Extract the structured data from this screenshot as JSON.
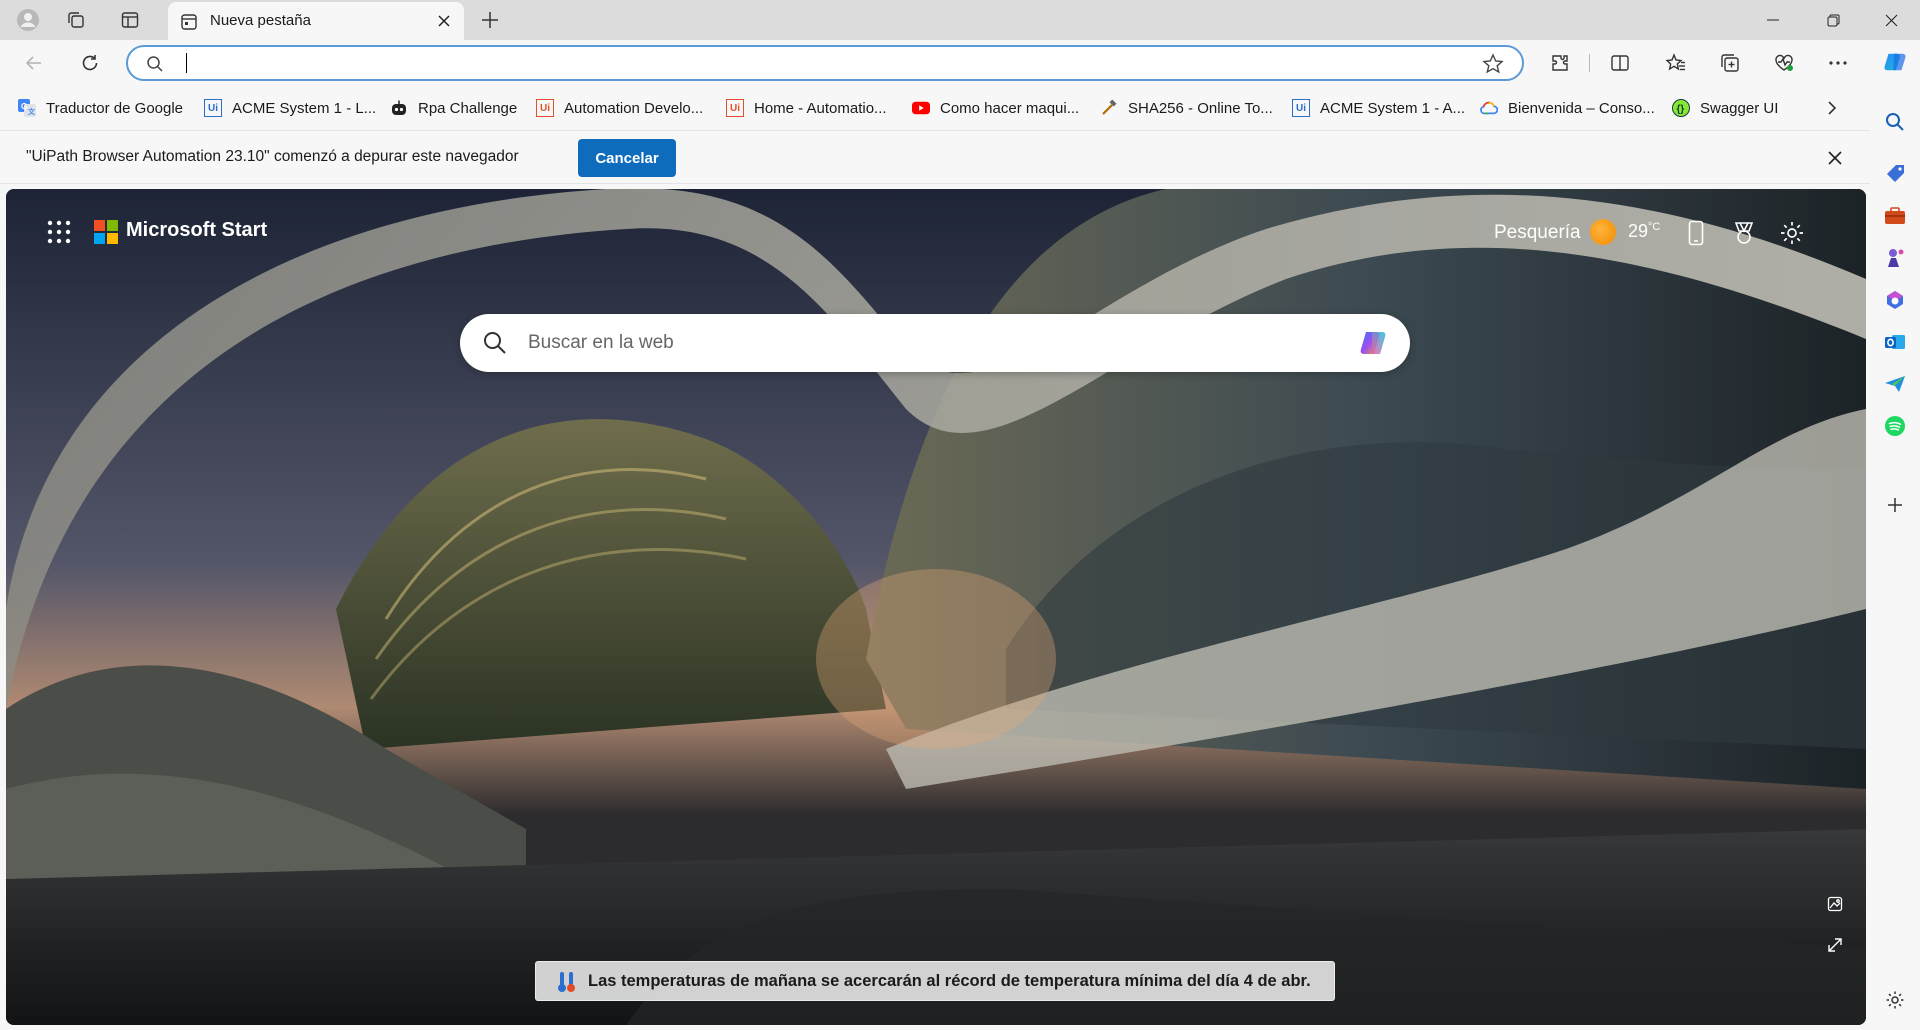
{
  "tab": {
    "title": "Nueva pestaña"
  },
  "address_bar": {
    "value": "",
    "placeholder": ""
  },
  "bookmarks": [
    {
      "label": "Traductor de Google",
      "icon": "google-translate-icon"
    },
    {
      "label": "ACME System 1 - L...",
      "icon": "uipath-icon"
    },
    {
      "label": "Rpa Challenge",
      "icon": "robot-icon"
    },
    {
      "label": "Automation Develo...",
      "icon": "uipath-icon"
    },
    {
      "label": "Home - Automatio...",
      "icon": "uipath-icon"
    },
    {
      "label": "Como hacer maqui...",
      "icon": "youtube-icon"
    },
    {
      "label": "SHA256 - Online To...",
      "icon": "tool-icon"
    },
    {
      "label": "ACME System 1 - A...",
      "icon": "uipath-icon"
    },
    {
      "label": "Bienvenida – Conso...",
      "icon": "google-cloud-icon"
    },
    {
      "label": "Swagger UI",
      "icon": "swagger-icon"
    }
  ],
  "infobar": {
    "message": "\"UiPath Browser Automation 23.10\" comenzó a depurar este navegador",
    "cancel_label": "Cancelar"
  },
  "start_page": {
    "brand": "Microsoft Start",
    "weather": {
      "city": "Pesquería",
      "temp": "29",
      "unit": "°C"
    },
    "search_placeholder": "Buscar en la web",
    "news_headline": "Las temperaturas de mañana se acercarán al récord de temperatura mínima del día 4 de abr."
  },
  "colors": {
    "accent": "#0f6cbd",
    "omnibox_border": "#5b9bd5",
    "weather_sun": "#f59a0c"
  }
}
